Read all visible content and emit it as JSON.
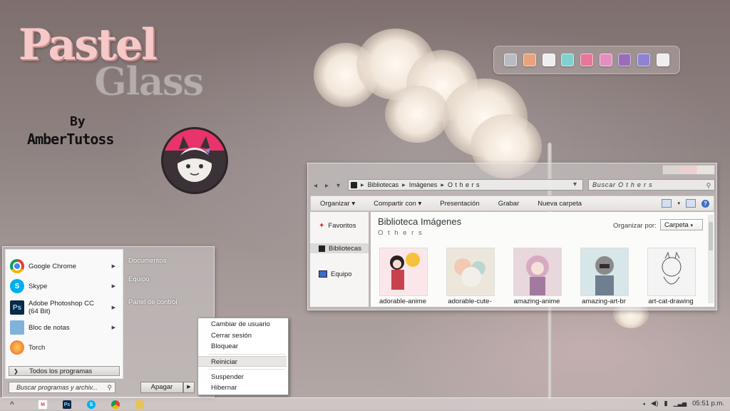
{
  "branding": {
    "title_line1": "Pastel",
    "title_line2": "Glass",
    "by": "By",
    "author": "AmberTutoss"
  },
  "dock": {
    "icons": [
      {
        "name": "tools-icon",
        "color": "#b7bcc3"
      },
      {
        "name": "photos-icon",
        "color": "#e9a27b"
      },
      {
        "name": "blank-app-icon",
        "color": "#eeeeee"
      },
      {
        "name": "teal-app-icon",
        "color": "#7fd1d0"
      },
      {
        "name": "heart-icon",
        "color": "#e8769b"
      },
      {
        "name": "music-icon",
        "color": "#e48dc0"
      },
      {
        "name": "image-icon",
        "color": "#9a6dbb"
      },
      {
        "name": "store-icon",
        "color": "#8f82d2"
      },
      {
        "name": "mail-icon",
        "color": "#eeeeee"
      }
    ]
  },
  "explorer": {
    "address": {
      "crumbs": [
        "Bibliotecas",
        "Imágenes",
        "O t h e r s"
      ]
    },
    "search_placeholder": "Buscar O t h e r s",
    "toolbar": {
      "organize": "Organizar",
      "share": "Compartir con",
      "slideshow": "Presentación",
      "burn": "Grabar",
      "new_folder": "Nueva carpeta"
    },
    "sidebar": {
      "favorites": "Favoritos",
      "libraries": "Bibliotecas",
      "computer": "Equipo"
    },
    "library_title": "Biblioteca Imágenes",
    "library_subtitle": "O t h e r s",
    "arrange_label": "Organizar por:",
    "arrange_value": "Carpeta",
    "files": [
      {
        "label": "adorable-anime",
        "color": "#e8b6b4"
      },
      {
        "label": "adorable-cute-",
        "color": "#d9d4c3"
      },
      {
        "label": "amazing-anime",
        "color": "#c6a3b3"
      },
      {
        "label": "amazing-art-br",
        "color": "#b9cdd1"
      },
      {
        "label": "art-cat-drawing",
        "color": "#d9d9d9"
      }
    ]
  },
  "start_menu": {
    "programs": [
      {
        "label": "Google Chrome"
      },
      {
        "label": "Skype"
      },
      {
        "label": "Adobe Photoshop CC",
        "sublabel": "(64 Bit)"
      },
      {
        "label": "Bloc de notas"
      },
      {
        "label": "Torch"
      }
    ],
    "all_programs": "Todos los programas",
    "links": {
      "documents": "Documentos",
      "computer": "Equipo",
      "control_panel": "Panel de control"
    },
    "search_placeholder": "Buscar programas y archiv...",
    "shutdown": "Apagar"
  },
  "context_menu": {
    "switch_user": "Cambiar de usuario",
    "logoff": "Cerrar sesión",
    "lock": "Bloquear",
    "restart": "Reiniciar",
    "sleep": "Suspender",
    "hibernate": "Hibernar"
  },
  "taskbar": {
    "clock": "05:51 p.m."
  }
}
